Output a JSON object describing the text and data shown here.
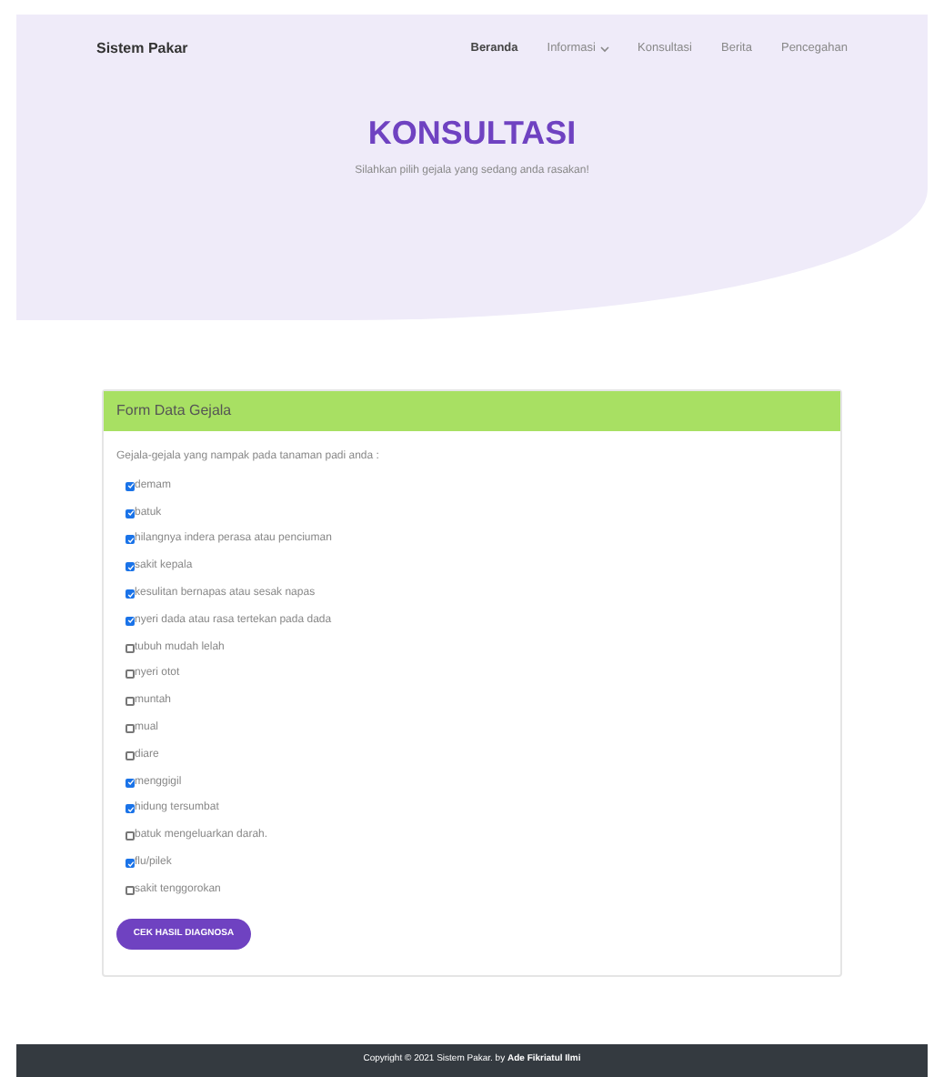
{
  "brand": "Sistem Pakar",
  "nav": [
    {
      "label": "Beranda",
      "selected": true,
      "dropdown": false
    },
    {
      "label": "Informasi",
      "selected": false,
      "dropdown": true
    },
    {
      "label": "Konsultasi",
      "selected": false,
      "dropdown": false
    },
    {
      "label": "Berita",
      "selected": false,
      "dropdown": false
    },
    {
      "label": "Pencegahan",
      "selected": false,
      "dropdown": false
    }
  ],
  "hero": {
    "title": "KONSULTASI",
    "subtitle": "Silahkan pilih gejala yang sedang anda rasakan!"
  },
  "form": {
    "title": "Form Data Gejala",
    "intro": "Gejala-gejala yang nampak pada tanaman padi anda :",
    "symptoms": [
      {
        "label": "demam",
        "checked": true
      },
      {
        "label": "batuk",
        "checked": true
      },
      {
        "label": "hilangnya indera perasa atau penciuman",
        "checked": true
      },
      {
        "label": "sakit kepala",
        "checked": true
      },
      {
        "label": "kesulitan bernapas atau sesak napas",
        "checked": true
      },
      {
        "label": "nyeri dada atau rasa tertekan pada dada",
        "checked": true
      },
      {
        "label": "tubuh mudah lelah",
        "checked": false
      },
      {
        "label": "nyeri otot",
        "checked": false
      },
      {
        "label": "muntah",
        "checked": false
      },
      {
        "label": "mual",
        "checked": false
      },
      {
        "label": "diare",
        "checked": false
      },
      {
        "label": "menggigil",
        "checked": true
      },
      {
        "label": "hidung tersumbat",
        "checked": true
      },
      {
        "label": "batuk mengeluarkan darah.",
        "checked": false
      },
      {
        "label": "flu/pilek",
        "checked": true
      },
      {
        "label": "sakit tenggorokan",
        "checked": false
      }
    ],
    "button": "CEK HASIL DIAGNOSA"
  },
  "footer": "Copyright © 2021 Sistem Pakar. by **Ade Fikriatul Ilmi**"
}
